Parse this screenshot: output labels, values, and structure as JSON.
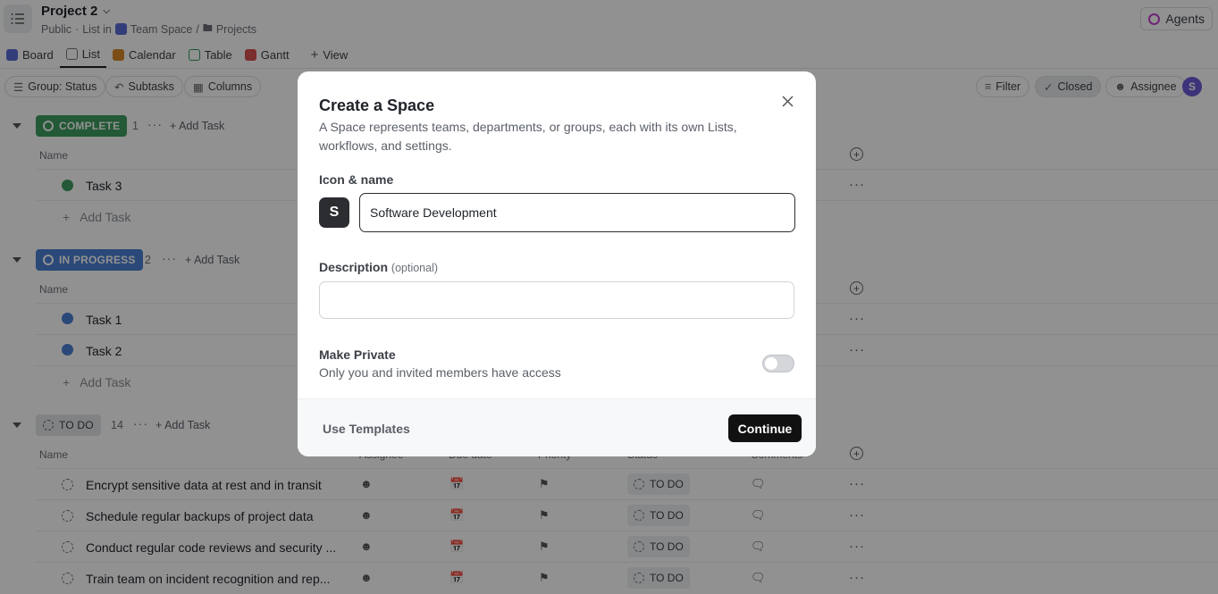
{
  "header": {
    "project_title": "Project 2",
    "visibility": "Public",
    "list_in": "List in",
    "space_name": "Team Space",
    "separator": "/",
    "folder_name": "Projects",
    "agents_label": "Agents"
  },
  "view_tabs": [
    {
      "label": "Board",
      "color": "#5a6bd6"
    },
    {
      "label": "List",
      "color": "#777777"
    },
    {
      "label": "Calendar",
      "color": "#d98a2b"
    },
    {
      "label": "Table",
      "color": "#2f9a5c"
    },
    {
      "label": "Gantt",
      "color": "#d6514f"
    },
    {
      "label": "View",
      "color": ""
    }
  ],
  "toolbar": {
    "group_status": "Group: Status",
    "subtasks": "Subtasks",
    "columns": "Columns",
    "filter": "Filter",
    "closed": "Closed",
    "assignee": "Assignee",
    "avatar_initial": "S"
  },
  "groups": {
    "complete": {
      "label": "COMPLETE",
      "count": "1",
      "add": "Add Task",
      "color": "#3f9d5f"
    },
    "in_progress": {
      "label": "IN PROGRESS",
      "count": "2",
      "add": "Add Task",
      "color": "#4a7fd4"
    },
    "todo": {
      "label": "TO DO",
      "count": "14",
      "add": "Add Task",
      "color": "#e3e5e8"
    }
  },
  "columns": {
    "name": "Name",
    "assignee": "Assignee",
    "due_date": "Due date",
    "priority": "Priority",
    "status": "Status",
    "comments": "Comments"
  },
  "tasks": {
    "complete": [
      "Task 3"
    ],
    "in_progress": [
      "Task 1",
      "Task 2"
    ],
    "todo": [
      "Encrypt sensitive data at rest and in transit",
      "Schedule regular backups of project data",
      "Conduct regular code reviews and security ...",
      "Train team on incident recognition and rep..."
    ],
    "add_task_label": "Add Task",
    "todo_status": "TO DO"
  },
  "modal": {
    "title": "Create a Space",
    "description": "A Space represents teams, departments, or groups, each with its own Lists, workflows, and settings.",
    "icon_name_label": "Icon & name",
    "icon_letter": "S",
    "name_value": "Software Development",
    "description_label": "Description",
    "description_optional": "(optional)",
    "description_value": "",
    "private_title": "Make Private",
    "private_sub": "Only you and invited members have access",
    "private_on": false,
    "use_templates": "Use Templates",
    "continue": "Continue"
  }
}
